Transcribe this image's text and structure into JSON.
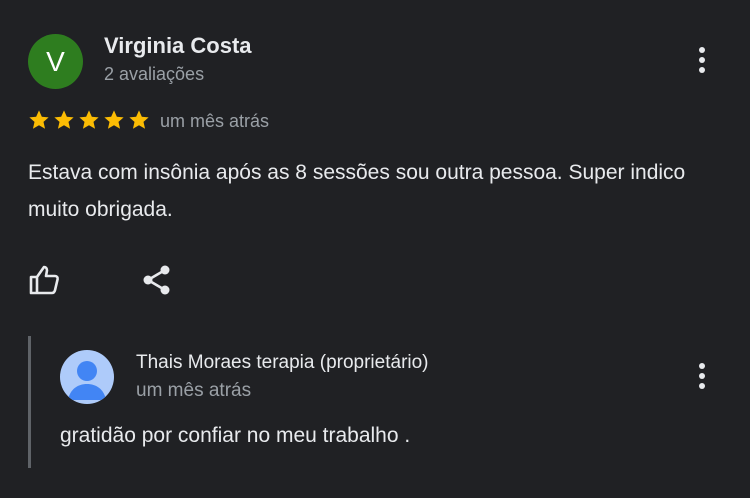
{
  "review": {
    "avatar_letter": "V",
    "avatar_color": "#2e7d1f",
    "author": "Virginia Costa",
    "author_meta": "2 avaliações",
    "rating": 5,
    "rating_max": 5,
    "star_color": "#fbbc04",
    "time": "um mês atrás",
    "text": "Estava com insônia após as 8 sessões sou outra pessoa. Super indico muito obrigada.",
    "actions": [
      "thumbs-up-icon",
      "share-icon"
    ]
  },
  "owner_reply": {
    "author": "Thais Moraes terapia (proprietário)",
    "time": "um mês atrás",
    "text": "gratidão por confiar no meu trabalho ."
  },
  "icons": {
    "more": "more-vert-icon",
    "like": "thumbs-up-icon",
    "share": "share-icon",
    "default_avatar": "person-icon"
  }
}
